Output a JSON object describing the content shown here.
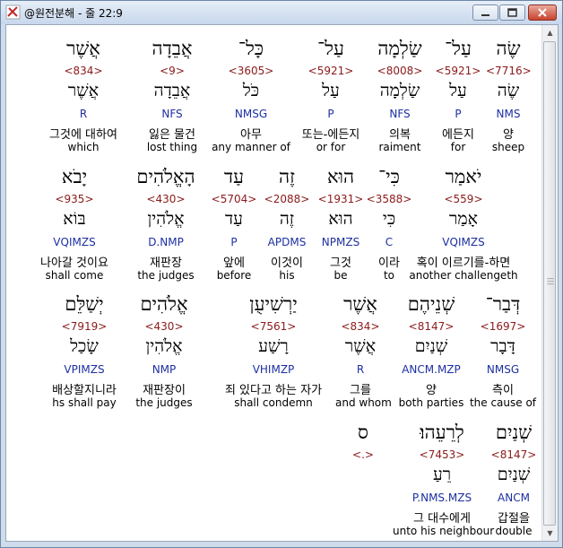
{
  "window": {
    "title": "@원전분해 - 줄 22:9"
  },
  "rows": [
    [
      {
        "heb": "שֶׂה",
        "num": "<7716>",
        "lemma": "שֶׂה",
        "gram": "NMS",
        "kor": "양",
        "eng": "sheep"
      },
      {
        "heb": "עַל־",
        "num": "<5921>",
        "lemma": "עַל",
        "gram": "P",
        "kor": "에든지",
        "eng": "for"
      },
      {
        "heb": "שַׂלְמָה",
        "num": "<8008>",
        "lemma": "שַׂלְמָה",
        "gram": "NFS",
        "kor": "의복",
        "eng": "raiment"
      },
      {
        "heb": "עַל־",
        "num": "<5921>",
        "lemma": "עַל",
        "gram": "P",
        "kor": "또는-에든지",
        "eng": "or for"
      },
      {
        "heb": "כָּל־",
        "num": "<3605>",
        "lemma": "כֹּל",
        "gram": "NMSG",
        "kor": "아무",
        "eng": "any manner of"
      },
      {
        "heb": "אֲבֵדָה",
        "num": "<9>",
        "lemma": "אֲבֵדָה",
        "gram": "NFS",
        "kor": "잃은 물건",
        "eng": "lost thing"
      },
      {
        "heb": "אֲשֶׁר",
        "num": "<834>",
        "lemma": "אֲשֶׁר",
        "gram": "R",
        "kor": "그것에 대하여",
        "eng": "which"
      }
    ],
    [
      {
        "heb": "יֹאמַר",
        "num": "<559>",
        "lemma": "אָמַר",
        "gram": "VQIMZS",
        "kor": "혹이 이르기를-하면",
        "eng": "another challengeth"
      },
      {
        "heb": "כִּי־",
        "num": "<3588>",
        "lemma": "כִּי",
        "gram": "C",
        "kor": "이라",
        "eng": "to"
      },
      {
        "heb": "הוּא",
        "num": "<1931>",
        "lemma": "הוּא",
        "gram": "NPMZS",
        "kor": "그것",
        "eng": "be"
      },
      {
        "heb": "זֶה",
        "num": "<2088>",
        "lemma": "זֶה",
        "gram": "APDMS",
        "kor": "이것이",
        "eng": "his"
      },
      {
        "heb": "עַד",
        "num": "<5704>",
        "lemma": "עַד",
        "gram": "P",
        "kor": "앞에",
        "eng": "before"
      },
      {
        "heb": "הָאֱלֹהִים",
        "num": "<430>",
        "lemma": "אֱלֹהִין",
        "gram": "D.NMP",
        "kor": "재판장",
        "eng": "the judges"
      },
      {
        "heb": "יָבֹא",
        "num": "<935>",
        "lemma": "בּוֹא",
        "gram": "VQIMZS",
        "kor": "나아갈 것이요",
        "eng": "shall come"
      }
    ],
    [
      {
        "heb": "דְּבַר־",
        "num": "<1697>",
        "lemma": "דָּבָר",
        "gram": "NMSG",
        "kor": "측이",
        "eng": "the cause of"
      },
      {
        "heb": "שְׁנֵיהֶם",
        "num": "<8147>",
        "lemma": "שְׁנַיִם",
        "gram": "ANCM.MZP",
        "kor": "양",
        "eng": "both parties"
      },
      {
        "heb": "אֲשֶׁר",
        "num": "<834>",
        "lemma": "אֲשֶׁר",
        "gram": "R",
        "kor": "그를",
        "eng": "and whom"
      },
      {
        "heb": "יַרְשִׁיעֻן",
        "num": "<7561>",
        "lemma": "רָשַׁע",
        "gram": "VHIMZP",
        "kor": "죄 있다고 하는 자가",
        "eng": "shall condemn"
      },
      {
        "heb": "אֱלֹהִים",
        "num": "<430>",
        "lemma": "אֱלֹהִין",
        "gram": "NMP",
        "kor": "재판장이",
        "eng": "the judges"
      },
      {
        "heb": "יְשַׁלֵּם",
        "num": "<7919>",
        "lemma": "שָׂכַל",
        "gram": "VPIMZS",
        "kor": "배상할지니라",
        "eng": "hs shall pay"
      }
    ],
    [
      {
        "heb": "שְׁנַיִם",
        "num": "<8147>",
        "lemma": "שְׁנַיִם",
        "gram": "ANCM",
        "kor": "갑절을",
        "eng": "double"
      },
      {
        "heb": "לְרֵעֵהוּ׃",
        "num": "<7453>",
        "lemma": "רֵעַ",
        "gram": "P.NMS.MZS",
        "kor": "그 대수에게",
        "eng": "unto his neighbour"
      },
      {
        "heb": "ס",
        "num": "<.>",
        "lemma": "",
        "gram": "",
        "kor": "",
        "eng": ""
      }
    ]
  ]
}
